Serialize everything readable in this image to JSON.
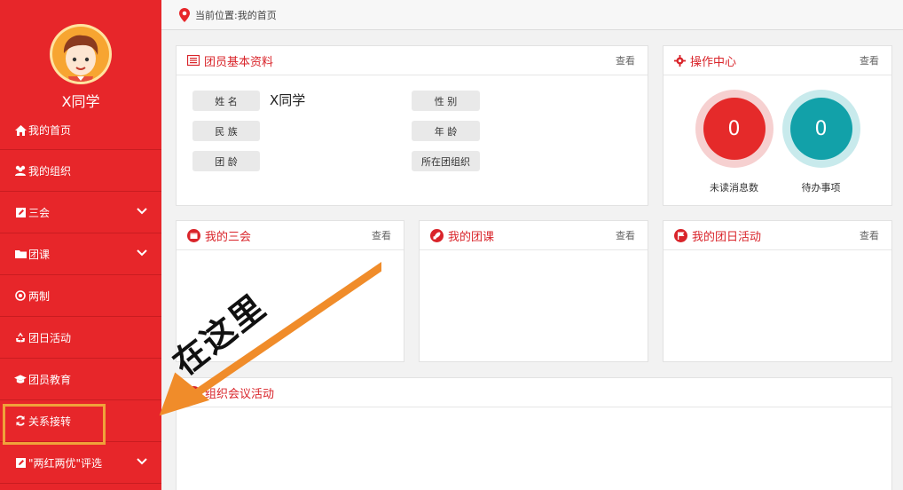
{
  "profile": {
    "name": "X同学"
  },
  "breadcrumb": {
    "text": "当前位置:我的首页"
  },
  "sidebar": {
    "items": [
      {
        "label": "我的首页",
        "icon": "home-icon",
        "expandable": false
      },
      {
        "label": "我的组织",
        "icon": "group-icon",
        "expandable": false
      },
      {
        "label": "三会",
        "icon": "edit-icon",
        "expandable": true
      },
      {
        "label": "团课",
        "icon": "folder-icon",
        "expandable": true
      },
      {
        "label": "两制",
        "icon": "target-icon",
        "expandable": false
      },
      {
        "label": "团日活动",
        "icon": "recycle-icon",
        "expandable": false
      },
      {
        "label": "团员教育",
        "icon": "graduation-cap-icon",
        "expandable": false
      },
      {
        "label": "关系接转",
        "icon": "refresh-icon",
        "expandable": false
      },
      {
        "label": "\"两红两优\"评选",
        "icon": "edit-icon",
        "expandable": true
      }
    ]
  },
  "basic_info": {
    "title": "团员基本资料",
    "more": "查看",
    "fields": [
      {
        "label": "姓 名",
        "value": "X同学"
      },
      {
        "label": "性 别",
        "value": ""
      },
      {
        "label": "民 族",
        "value": ""
      },
      {
        "label": "年 龄",
        "value": ""
      },
      {
        "label": "团 龄",
        "value": ""
      },
      {
        "label": "所在团组织",
        "value": ""
      }
    ]
  },
  "ops_center": {
    "title": "操作中心",
    "more": "查看",
    "items": [
      {
        "value": "0",
        "label": "未读消息数",
        "color": "#e52a2a",
        "ring": "#f6d0d0"
      },
      {
        "value": "0",
        "label": "待办事项",
        "color": "#12a1a9",
        "ring": "#c8eaec"
      }
    ]
  },
  "panels": {
    "sanhui": {
      "title": "我的三会",
      "more": "查看"
    },
    "tuanke": {
      "title": "我的团课",
      "more": "查看"
    },
    "tuanri": {
      "title": "我的团日活动",
      "more": "查看"
    },
    "meeting": {
      "title": "组织会议活动"
    }
  },
  "annotation": {
    "text": "在这里"
  },
  "colors": {
    "brand": "#e7262a",
    "highlight": "#f0a23a"
  }
}
